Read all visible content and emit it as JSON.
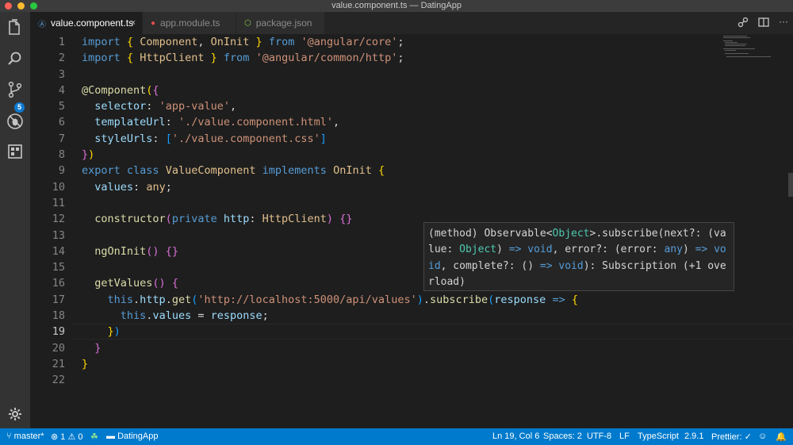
{
  "window": {
    "title": "value.component.ts — DatingApp"
  },
  "tabs": [
    {
      "label": "value.component.ts",
      "icon": "angular-component-icon",
      "close": "×"
    },
    {
      "label": "app.module.ts",
      "icon": "angular-module-icon"
    },
    {
      "label": "package.json",
      "icon": "npm-icon"
    }
  ],
  "activity": {
    "scm_badge": "5"
  },
  "editor": {
    "current_line": 19,
    "line_numbers": [
      "1",
      "2",
      "3",
      "4",
      "5",
      "6",
      "7",
      "8",
      "9",
      "10",
      "11",
      "12",
      "13",
      "14",
      "15",
      "16",
      "17",
      "18",
      "19",
      "20",
      "21",
      "22"
    ],
    "lines": [
      [
        [
          "kw",
          "import"
        ],
        [
          "pl",
          " "
        ],
        [
          "br1",
          "{"
        ],
        [
          "pl",
          " "
        ],
        [
          "cls",
          "Component"
        ],
        [
          "pl",
          ", "
        ],
        [
          "cls",
          "OnInit"
        ],
        [
          "pl",
          " "
        ],
        [
          "br1",
          "}"
        ],
        [
          "pl",
          " "
        ],
        [
          "kw",
          "from"
        ],
        [
          "pl",
          " "
        ],
        [
          "str",
          "'@angular/core'"
        ],
        [
          "pl",
          ";"
        ]
      ],
      [
        [
          "kw",
          "import"
        ],
        [
          "pl",
          " "
        ],
        [
          "br1",
          "{"
        ],
        [
          "pl",
          " "
        ],
        [
          "cls",
          "HttpClient"
        ],
        [
          "pl",
          " "
        ],
        [
          "br1",
          "}"
        ],
        [
          "pl",
          " "
        ],
        [
          "kw",
          "from"
        ],
        [
          "pl",
          " "
        ],
        [
          "str",
          "'@angular/common/http'"
        ],
        [
          "pl",
          ";"
        ]
      ],
      [],
      [
        [
          "deco",
          "@Component"
        ],
        [
          "br1",
          "("
        ],
        [
          "br2",
          "{"
        ]
      ],
      [
        [
          "pl",
          "  "
        ],
        [
          "prop",
          "selector"
        ],
        [
          "pl",
          ": "
        ],
        [
          "str",
          "'app-value'"
        ],
        [
          "pl",
          ","
        ]
      ],
      [
        [
          "pl",
          "  "
        ],
        [
          "prop",
          "templateUrl"
        ],
        [
          "pl",
          ": "
        ],
        [
          "str",
          "'./value.component.html'"
        ],
        [
          "pl",
          ","
        ]
      ],
      [
        [
          "pl",
          "  "
        ],
        [
          "prop",
          "styleUrls"
        ],
        [
          "pl",
          ": "
        ],
        [
          "br3",
          "["
        ],
        [
          "str",
          "'./value.component.css'"
        ],
        [
          "br3",
          "]"
        ]
      ],
      [
        [
          "br2",
          "}"
        ],
        [
          "br1",
          ")"
        ]
      ],
      [
        [
          "kw",
          "export"
        ],
        [
          "pl",
          " "
        ],
        [
          "kw",
          "class"
        ],
        [
          "pl",
          " "
        ],
        [
          "cls",
          "ValueComponent"
        ],
        [
          "pl",
          " "
        ],
        [
          "kw",
          "implements"
        ],
        [
          "pl",
          " "
        ],
        [
          "cls",
          "OnInit"
        ],
        [
          "pl",
          " "
        ],
        [
          "br1",
          "{"
        ]
      ],
      [
        [
          "pl",
          "  "
        ],
        [
          "prop",
          "values"
        ],
        [
          "pl",
          ": "
        ],
        [
          "cls",
          "any"
        ],
        [
          "pl",
          ";"
        ]
      ],
      [],
      [
        [
          "pl",
          "  "
        ],
        [
          "fn",
          "constructor"
        ],
        [
          "br2",
          "("
        ],
        [
          "kw",
          "private"
        ],
        [
          "pl",
          " "
        ],
        [
          "prop",
          "http"
        ],
        [
          "pl",
          ": "
        ],
        [
          "cls",
          "HttpClient"
        ],
        [
          "br2",
          ")"
        ],
        [
          "pl",
          " "
        ],
        [
          "br2",
          "{}"
        ]
      ],
      [],
      [
        [
          "pl",
          "  "
        ],
        [
          "fn",
          "ngOnInit"
        ],
        [
          "br2",
          "()"
        ],
        [
          "pl",
          " "
        ],
        [
          "br2",
          "{}"
        ]
      ],
      [],
      [
        [
          "pl",
          "  "
        ],
        [
          "fn",
          "getValues"
        ],
        [
          "br2",
          "()"
        ],
        [
          "pl",
          " "
        ],
        [
          "br2",
          "{"
        ]
      ],
      [
        [
          "pl",
          "    "
        ],
        [
          "kw",
          "this"
        ],
        [
          "pl",
          "."
        ],
        [
          "prop",
          "http"
        ],
        [
          "pl",
          "."
        ],
        [
          "fn",
          "get"
        ],
        [
          "br3",
          "("
        ],
        [
          "str",
          "'http://localhost:5000/api/values'"
        ],
        [
          "br3",
          ")"
        ],
        [
          "pl",
          "."
        ],
        [
          "fn",
          "subscribe"
        ],
        [
          "br3",
          "("
        ],
        [
          "prop",
          "response"
        ],
        [
          "pl",
          " "
        ],
        [
          "kw",
          "=>"
        ],
        [
          "pl",
          " "
        ],
        [
          "br1",
          "{"
        ]
      ],
      [
        [
          "pl",
          "      "
        ],
        [
          "kw",
          "this"
        ],
        [
          "pl",
          "."
        ],
        [
          "prop",
          "values"
        ],
        [
          "pl",
          " = "
        ],
        [
          "prop",
          "response"
        ],
        [
          "pl",
          ";"
        ]
      ],
      [
        [
          "pl",
          "    "
        ],
        [
          "br1",
          "}"
        ],
        [
          "br3",
          ")"
        ]
      ],
      [
        [
          "pl",
          "  "
        ],
        [
          "br2",
          "}"
        ]
      ],
      [
        [
          "br1",
          "}"
        ]
      ],
      []
    ]
  },
  "hover": {
    "parts": [
      [
        "pl",
        "(method) Observable<"
      ],
      [
        "cls",
        "Object"
      ],
      [
        "pl",
        ">.subscribe(next?: (value: "
      ],
      [
        "cls",
        "Object"
      ],
      [
        "pl",
        ") "
      ],
      [
        "op",
        "=>"
      ],
      [
        "pl",
        " "
      ],
      [
        "kw",
        "void"
      ],
      [
        "pl",
        ", error?: (error: "
      ],
      [
        "kw",
        "any"
      ],
      [
        "pl",
        ") "
      ],
      [
        "op",
        "=>"
      ],
      [
        "pl",
        " "
      ],
      [
        "kw",
        "void"
      ],
      [
        "pl",
        ", complete?: () "
      ],
      [
        "op",
        "=>"
      ],
      [
        "pl",
        " "
      ],
      [
        "kw",
        "void"
      ],
      [
        "pl",
        "): Subscription (+1 overload)"
      ]
    ]
  },
  "status": {
    "branch": "master*",
    "errors": "1",
    "warnings": "0",
    "folder": "DatingApp",
    "position": "Ln 19, Col 6",
    "spaces": "Spaces: 2",
    "encoding": "UTF-8",
    "eol": "LF",
    "language": "TypeScript",
    "version": "2.9.1",
    "formatter": "Prettier: ✓"
  },
  "colors": {
    "accent": "#007acc",
    "badge": "#0e7ad3"
  }
}
